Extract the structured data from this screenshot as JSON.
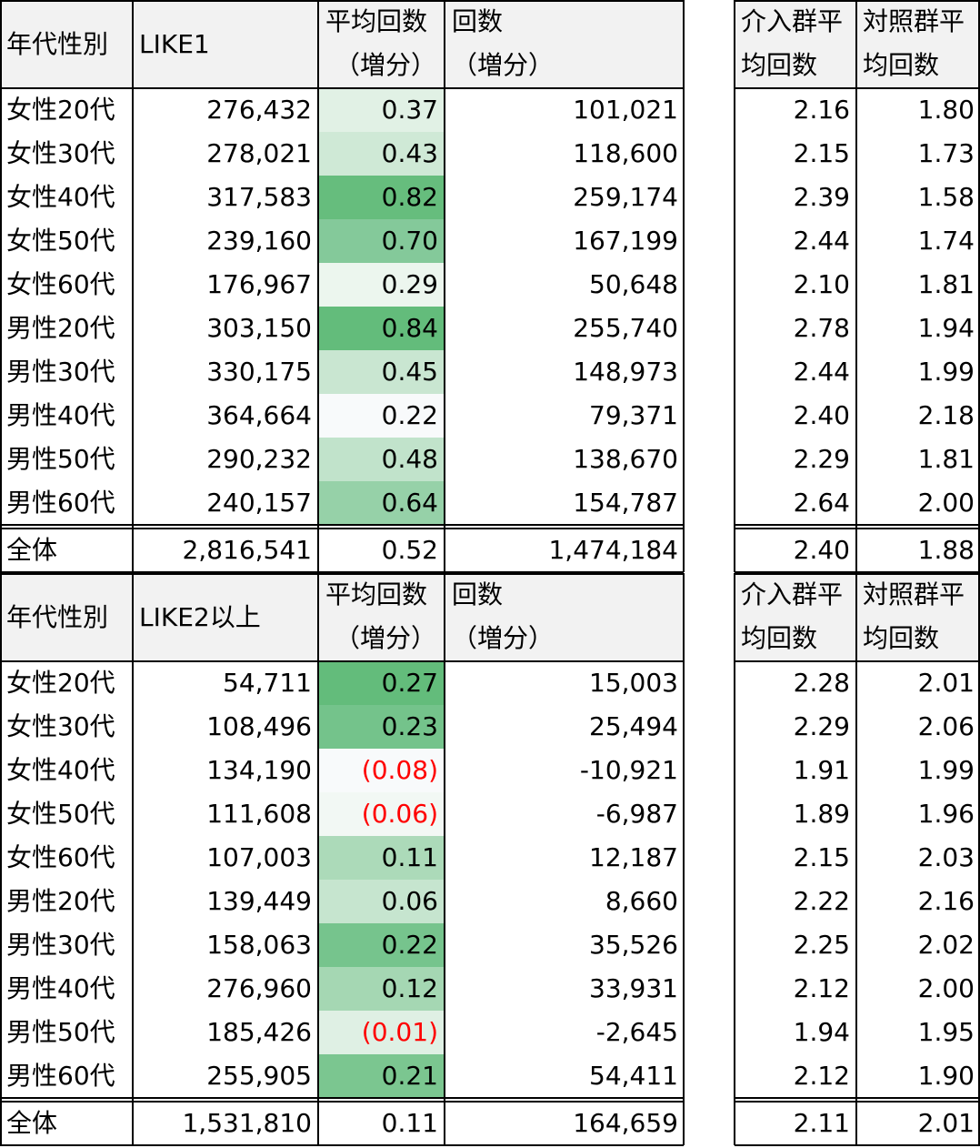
{
  "sections": [
    {
      "header": {
        "group": "年代性別",
        "name": "LIKE1",
        "avg_l1": "平均回数",
        "avg_l2": "（増分）",
        "cnt_l1": "回数",
        "cnt_l2": "（増分）",
        "int_l1": "介入群平",
        "int_l2": "均回数",
        "ctl_l1": "対照群平",
        "ctl_l2": "均回数"
      },
      "rows": [
        {
          "label": "女性20代",
          "like": "276,432",
          "avg": "0.37",
          "cnt": "101,021",
          "int": "2.16",
          "ctl": "1.80",
          "neg": false,
          "shade": "#e1f1e5"
        },
        {
          "label": "女性30代",
          "like": "278,021",
          "avg": "0.43",
          "cnt": "118,600",
          "int": "2.15",
          "ctl": "1.73",
          "neg": false,
          "shade": "#cfe9d6"
        },
        {
          "label": "女性40代",
          "like": "317,583",
          "avg": "0.82",
          "cnt": "259,174",
          "int": "2.39",
          "ctl": "1.58",
          "neg": false,
          "shade": "#66bd7d"
        },
        {
          "label": "女性50代",
          "like": "239,160",
          "avg": "0.70",
          "cnt": "167,199",
          "int": "2.44",
          "ctl": "1.74",
          "neg": false,
          "shade": "#84c99a"
        },
        {
          "label": "女性60代",
          "like": "176,967",
          "avg": "0.29",
          "cnt": "50,648",
          "int": "2.10",
          "ctl": "1.81",
          "neg": false,
          "shade": "#ecf6ee"
        },
        {
          "label": "男性20代",
          "like": "303,150",
          "avg": "0.84",
          "cnt": "255,740",
          "int": "2.78",
          "ctl": "1.94",
          "neg": false,
          "shade": "#63bc7b"
        },
        {
          "label": "男性30代",
          "like": "330,175",
          "avg": "0.45",
          "cnt": "148,973",
          "int": "2.44",
          "ctl": "1.99",
          "neg": false,
          "shade": "#c9e6d1"
        },
        {
          "label": "男性40代",
          "like": "364,664",
          "avg": "0.22",
          "cnt": "79,371",
          "int": "2.40",
          "ctl": "2.18",
          "neg": false,
          "shade": "#f8fafb"
        },
        {
          "label": "男性50代",
          "like": "290,232",
          "avg": "0.48",
          "cnt": "138,670",
          "int": "2.29",
          "ctl": "1.81",
          "neg": false,
          "shade": "#c1e3cb"
        },
        {
          "label": "男性60代",
          "like": "240,157",
          "avg": "0.64",
          "cnt": "154,787",
          "int": "2.64",
          "ctl": "2.00",
          "neg": false,
          "shade": "#96d1a8"
        }
      ],
      "total": {
        "label": "全体",
        "like": "2,816,541",
        "avg": "0.52",
        "cnt": "1,474,184",
        "int": "2.40",
        "ctl": "1.88"
      }
    },
    {
      "header": {
        "group": "年代性別",
        "name": "LIKE2以上",
        "avg_l1": "平均回数",
        "avg_l2": "（増分）",
        "cnt_l1": "回数",
        "cnt_l2": "（増分）",
        "int_l1": "介入群平",
        "int_l2": "均回数",
        "ctl_l1": "対照群平",
        "ctl_l2": "均回数"
      },
      "rows": [
        {
          "label": "女性20代",
          "like": "54,711",
          "avg": "0.27",
          "cnt": "15,003",
          "int": "2.28",
          "ctl": "2.01",
          "neg": false,
          "shade": "#63bc7b"
        },
        {
          "label": "女性30代",
          "like": "108,496",
          "avg": "0.23",
          "cnt": "25,494",
          "int": "2.29",
          "ctl": "2.06",
          "neg": false,
          "shade": "#74c38b"
        },
        {
          "label": "女性40代",
          "like": "134,190",
          "avg": "(0.08)",
          "cnt": "-10,921",
          "int": "1.91",
          "ctl": "1.99",
          "neg": true,
          "shade": "#f8fafb"
        },
        {
          "label": "女性50代",
          "like": "111,608",
          "avg": "(0.06)",
          "cnt": "-6,987",
          "int": "1.89",
          "ctl": "1.96",
          "neg": true,
          "shade": "#f2f8f4"
        },
        {
          "label": "女性60代",
          "like": "107,003",
          "avg": "0.11",
          "cnt": "12,187",
          "int": "2.15",
          "ctl": "2.03",
          "neg": false,
          "shade": "#acdab9"
        },
        {
          "label": "男性20代",
          "like": "139,449",
          "avg": "0.06",
          "cnt": "8,660",
          "int": "2.22",
          "ctl": "2.16",
          "neg": false,
          "shade": "#c6e5cf"
        },
        {
          "label": "男性30代",
          "like": "158,063",
          "avg": "0.22",
          "cnt": "35,526",
          "int": "2.25",
          "ctl": "2.02",
          "neg": false,
          "shade": "#76c48d"
        },
        {
          "label": "男性40代",
          "like": "276,960",
          "avg": "0.12",
          "cnt": "33,931",
          "int": "2.12",
          "ctl": "2.00",
          "neg": false,
          "shade": "#a5d7b3"
        },
        {
          "label": "男性50代",
          "like": "185,426",
          "avg": "(0.01)",
          "cnt": "-2,645",
          "int": "1.94",
          "ctl": "1.95",
          "neg": true,
          "shade": "#dff0e4"
        },
        {
          "label": "男性60代",
          "like": "255,905",
          "avg": "0.21",
          "cnt": "54,411",
          "int": "2.12",
          "ctl": "1.90",
          "neg": false,
          "shade": "#7bc690"
        }
      ],
      "total": {
        "label": "全体",
        "like": "1,531,810",
        "avg": "0.11",
        "cnt": "164,659",
        "int": "2.11",
        "ctl": "2.01"
      }
    }
  ],
  "colors": {
    "header_bg": "#f2f2f2",
    "negative_text": "#ff0000",
    "heat_high": "#63bc7b",
    "heat_low": "#f8fafb"
  }
}
